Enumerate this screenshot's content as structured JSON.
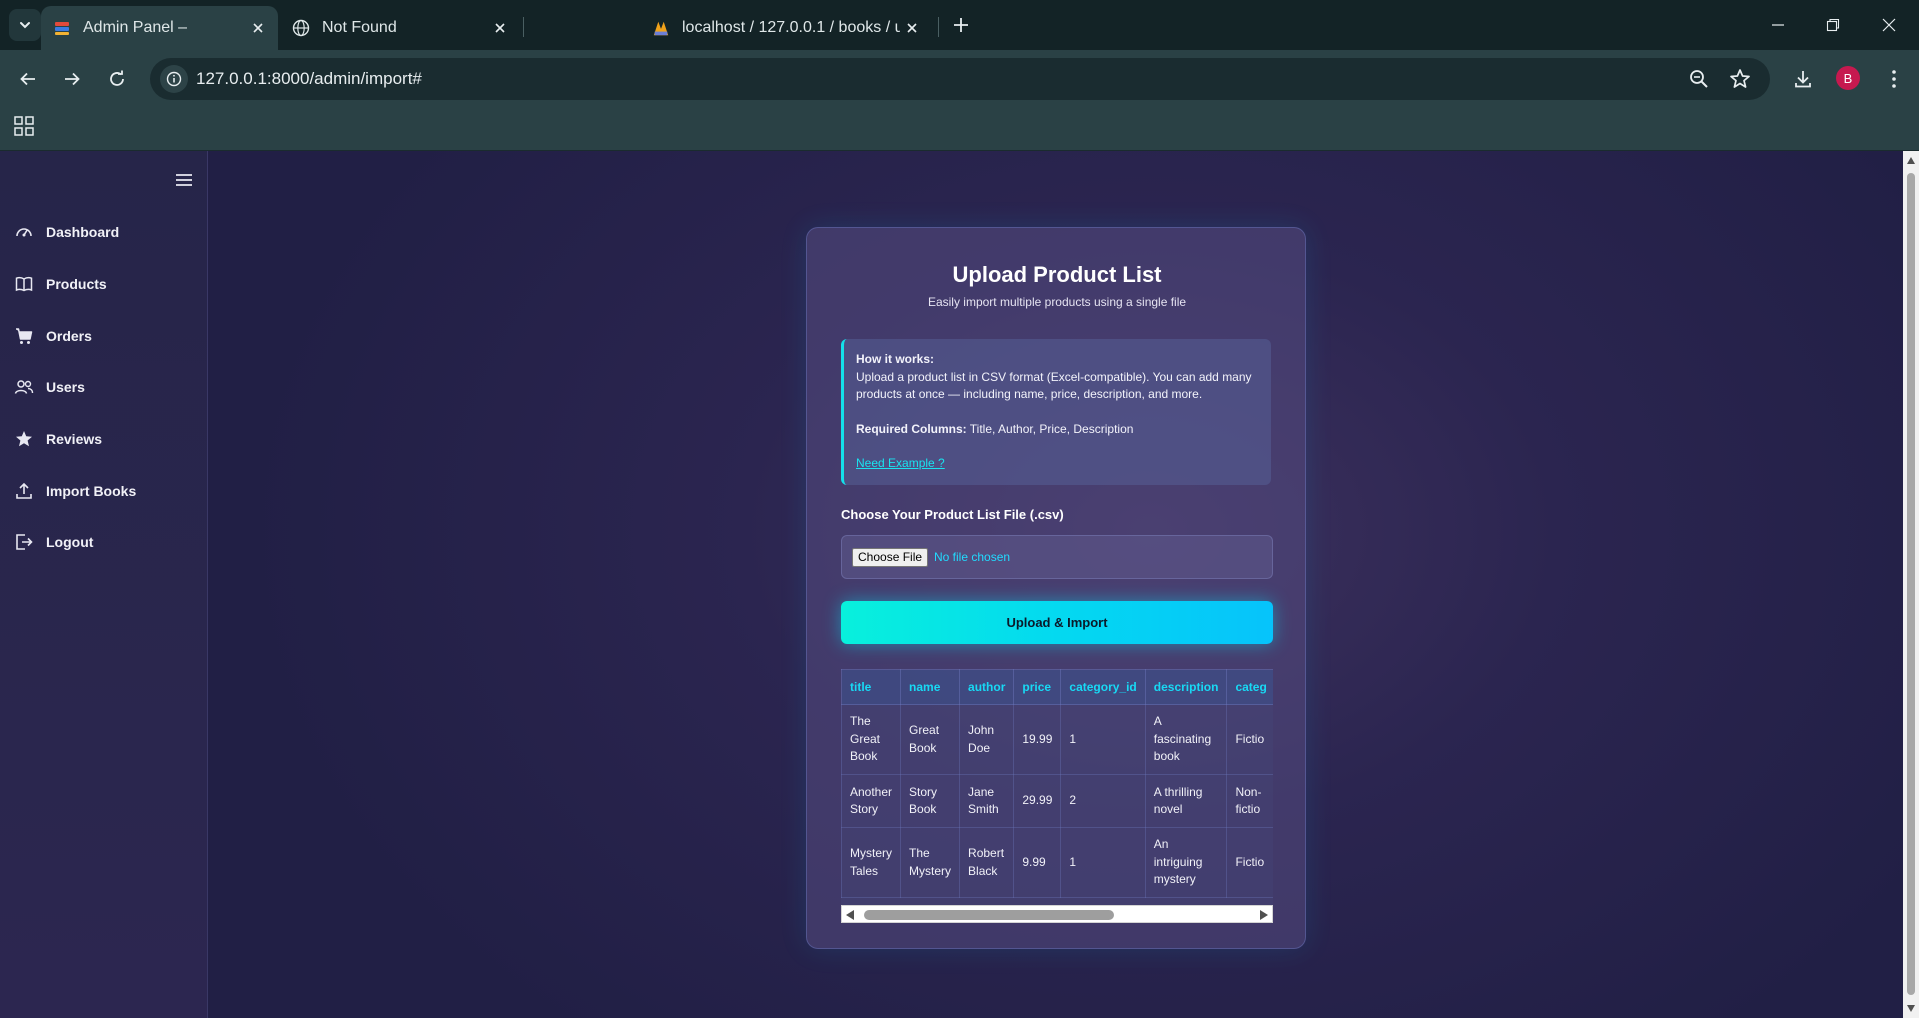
{
  "browser": {
    "tabs": [
      {
        "title": "Admin Panel –",
        "icon": "app-favicon",
        "active": true
      },
      {
        "title": "Not Found",
        "icon": "globe-icon",
        "active": false
      },
      {
        "title": "localhost / 127.0.0.1 / books / u",
        "icon": "phpmyadmin-icon",
        "active": false
      }
    ],
    "url": "127.0.0.1:8000/admin/import#",
    "profile_initial": "B",
    "profile_color": "#c6194f"
  },
  "sidebar": {
    "items": [
      {
        "label": "Dashboard",
        "icon": "gauge-icon"
      },
      {
        "label": "Products",
        "icon": "book-icon"
      },
      {
        "label": "Orders",
        "icon": "cart-icon"
      },
      {
        "label": "Users",
        "icon": "users-icon"
      },
      {
        "label": "Reviews",
        "icon": "star-icon"
      },
      {
        "label": "Import Books",
        "icon": "upload-icon"
      },
      {
        "label": "Logout",
        "icon": "logout-icon"
      }
    ]
  },
  "card": {
    "title": "Upload Product List",
    "subtitle": "Easily import multiple products using a single file",
    "how": {
      "heading": "How it works:",
      "body": "Upload a product list in CSV format (Excel-compatible). You can add many products at once — including name, price, description, and more.",
      "required_label": "Required Columns:",
      "required_value": " Title, Author, Price, Description",
      "example_link": "Need Example ?"
    },
    "file_label": "Choose Your Product List File (.csv)",
    "file_button": "Choose File",
    "file_status": "No file chosen",
    "upload_button": "Upload & Import",
    "accent_color": "#14e0ea"
  },
  "table": {
    "headers": [
      "title",
      "name",
      "author",
      "price",
      "category_id",
      "description",
      "categ"
    ],
    "rows": [
      [
        "The Great Book",
        "Great Book",
        "John Doe",
        "19.99",
        "1",
        "A fascinating book",
        "Fictio"
      ],
      [
        "Another Story",
        "Story Book",
        "Jane Smith",
        "29.99",
        "2",
        "A thrilling novel",
        "Non-fictio"
      ],
      [
        "Mystery Tales",
        "The Mystery",
        "Robert Black",
        "9.99",
        "1",
        "An intriguing mystery",
        "Fictio"
      ]
    ]
  }
}
